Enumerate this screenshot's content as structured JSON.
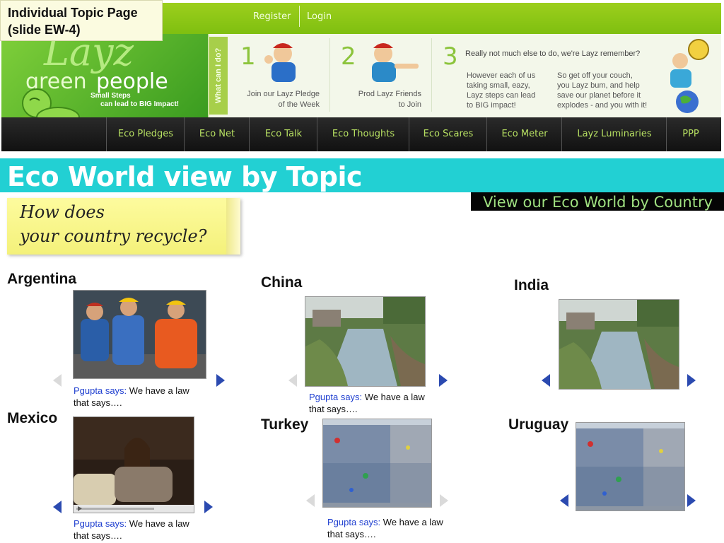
{
  "slide_label": {
    "line1": "Individual Topic Page",
    "line2": "(slide EW-4)"
  },
  "header": {
    "top_links": {
      "register": "Register",
      "login": "Login"
    },
    "logo": {
      "word1": "Layz",
      "word2": "green",
      "word3": "people",
      "tagline1": "Small Steps",
      "tagline2": "can lead to BIG Impact!"
    },
    "side_tab": "What can I do?",
    "steps": [
      {
        "number": "1",
        "line1": "Join our Layz Pledge",
        "line2": "of the Week"
      },
      {
        "number": "2",
        "line1": "Prod Layz Friends",
        "line2": "to Join"
      },
      {
        "number": "3",
        "heading": "Really not much else to do, we're Layz remember?",
        "col1": [
          "However each of us",
          "taking small, eazy,",
          "Layz steps can lead",
          "to BIG impact!"
        ],
        "col2": [
          "So get off your couch,",
          "you Layz bum, and help",
          "save our planet before it",
          "explodes - and you with it!"
        ]
      }
    ],
    "nav": [
      "Eco Pledges",
      "Eco Net",
      "Eco Talk",
      "Eco Thoughts",
      "Eco Scares",
      "Eco Meter",
      "Layz Luminaries",
      "PPP"
    ]
  },
  "page_title": "Eco World view by Topic",
  "country_link": "View our Eco World by Country",
  "sticky_note": {
    "line1": "How does",
    "line2": "your country recycle?"
  },
  "countries": [
    {
      "name": "Argentina",
      "author": "Pgupta says:",
      "comment": "We have a law that says…."
    },
    {
      "name": "China",
      "author": "Pgupta says:",
      "comment": "We have a law that says…."
    },
    {
      "name": "India",
      "author": "",
      "comment": ""
    },
    {
      "name": "Mexico",
      "author": "Pgupta says:",
      "comment": "We have a law that says…."
    },
    {
      "name": "Turkey",
      "author": "Pgupta says:",
      "comment": "We have a law that says…."
    },
    {
      "name": "Uruguay",
      "author": "",
      "comment": ""
    }
  ],
  "colors": {
    "brand_green": "#8cc43c",
    "banner_cyan": "#22d0d3",
    "nav_text": "#b7e062",
    "author_blue": "#1f3fd0",
    "arrow_blue": "#2b4ab0"
  }
}
